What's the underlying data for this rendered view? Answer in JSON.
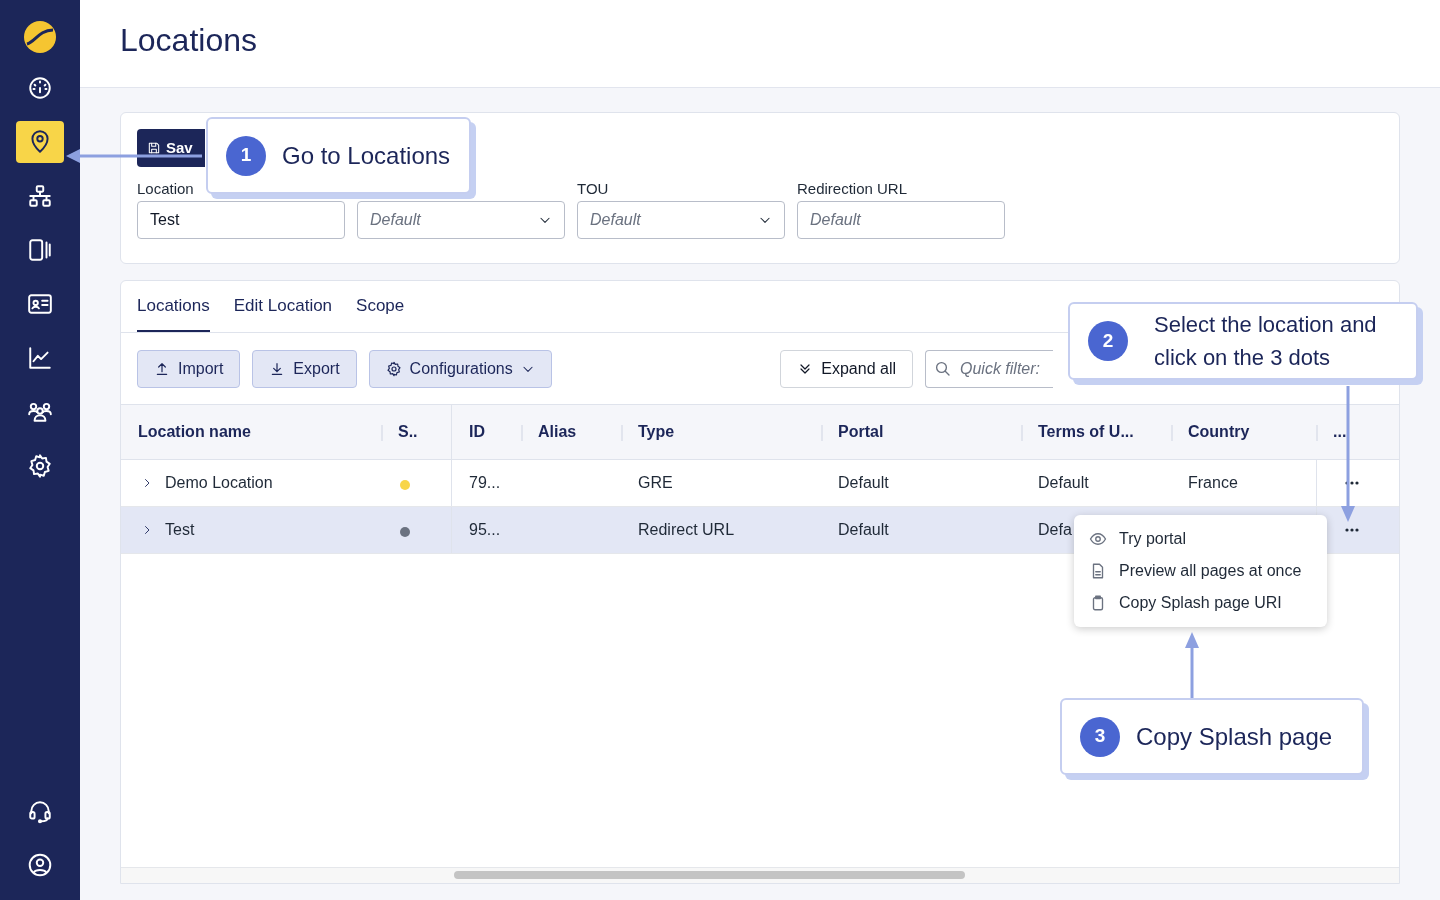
{
  "sidebar": {
    "items": [
      {
        "selected": false
      },
      {
        "selected": true
      },
      {
        "selected": false
      },
      {
        "selected": false
      },
      {
        "selected": false
      },
      {
        "selected": false
      },
      {
        "selected": false
      },
      {
        "selected": false
      }
    ],
    "footer_items": [
      {
        "selected": false
      },
      {
        "selected": false
      }
    ]
  },
  "page_title": "Locations",
  "form": {
    "save_button": "Sav",
    "fields": [
      {
        "kind": "text",
        "label": "Location",
        "value": "Test"
      },
      {
        "kind": "select",
        "placeholder": "Default"
      },
      {
        "kind": "select",
        "label": "TOU",
        "placeholder": "Default"
      },
      {
        "kind": "text",
        "label": "Redirection URL",
        "placeholder": "Default"
      }
    ]
  },
  "tabs": [
    {
      "label": "Locations",
      "selected": true
    },
    {
      "label": "Edit Location",
      "selected": false
    },
    {
      "label": "Scope",
      "selected": false
    }
  ],
  "toolbar": {
    "buttons": [
      {
        "kind": "import",
        "label": "Import"
      },
      {
        "kind": "export",
        "label": "Export"
      },
      {
        "kind": "menu",
        "label": "Configurations"
      }
    ],
    "expand_button": "Expand all",
    "quick_filter": {
      "placeholder": "Quick filter:"
    }
  },
  "table": {
    "columns": [
      "Location name",
      "S..",
      "ID",
      "Alias",
      "Type",
      "Portal",
      "Terms of U...",
      "Country",
      "..."
    ],
    "rows": [
      {
        "name": "Demo Location",
        "color": "#f8d548",
        "id": "79...",
        "type": "GRE",
        "portal": "Default",
        "terms": "Default",
        "country": "France",
        "selected": false
      },
      {
        "name": "Test",
        "color": "#6b7280",
        "id": "95...",
        "type": "Redirect URL",
        "portal": "Default",
        "terms": "Defa",
        "selected": true
      }
    ]
  },
  "context_menu": {
    "items": [
      {
        "kind": "eye",
        "label": "Try portal"
      },
      {
        "kind": "document",
        "label": "Preview all pages at once"
      },
      {
        "kind": "clipboard",
        "label": "Copy Splash page URI"
      }
    ]
  },
  "callouts": [
    {
      "number": "1",
      "text": "Go to Locations"
    },
    {
      "number": "2",
      "text": "Select the location and click on the 3 dots"
    },
    {
      "number": "3",
      "text": "Copy Splash page"
    }
  ]
}
